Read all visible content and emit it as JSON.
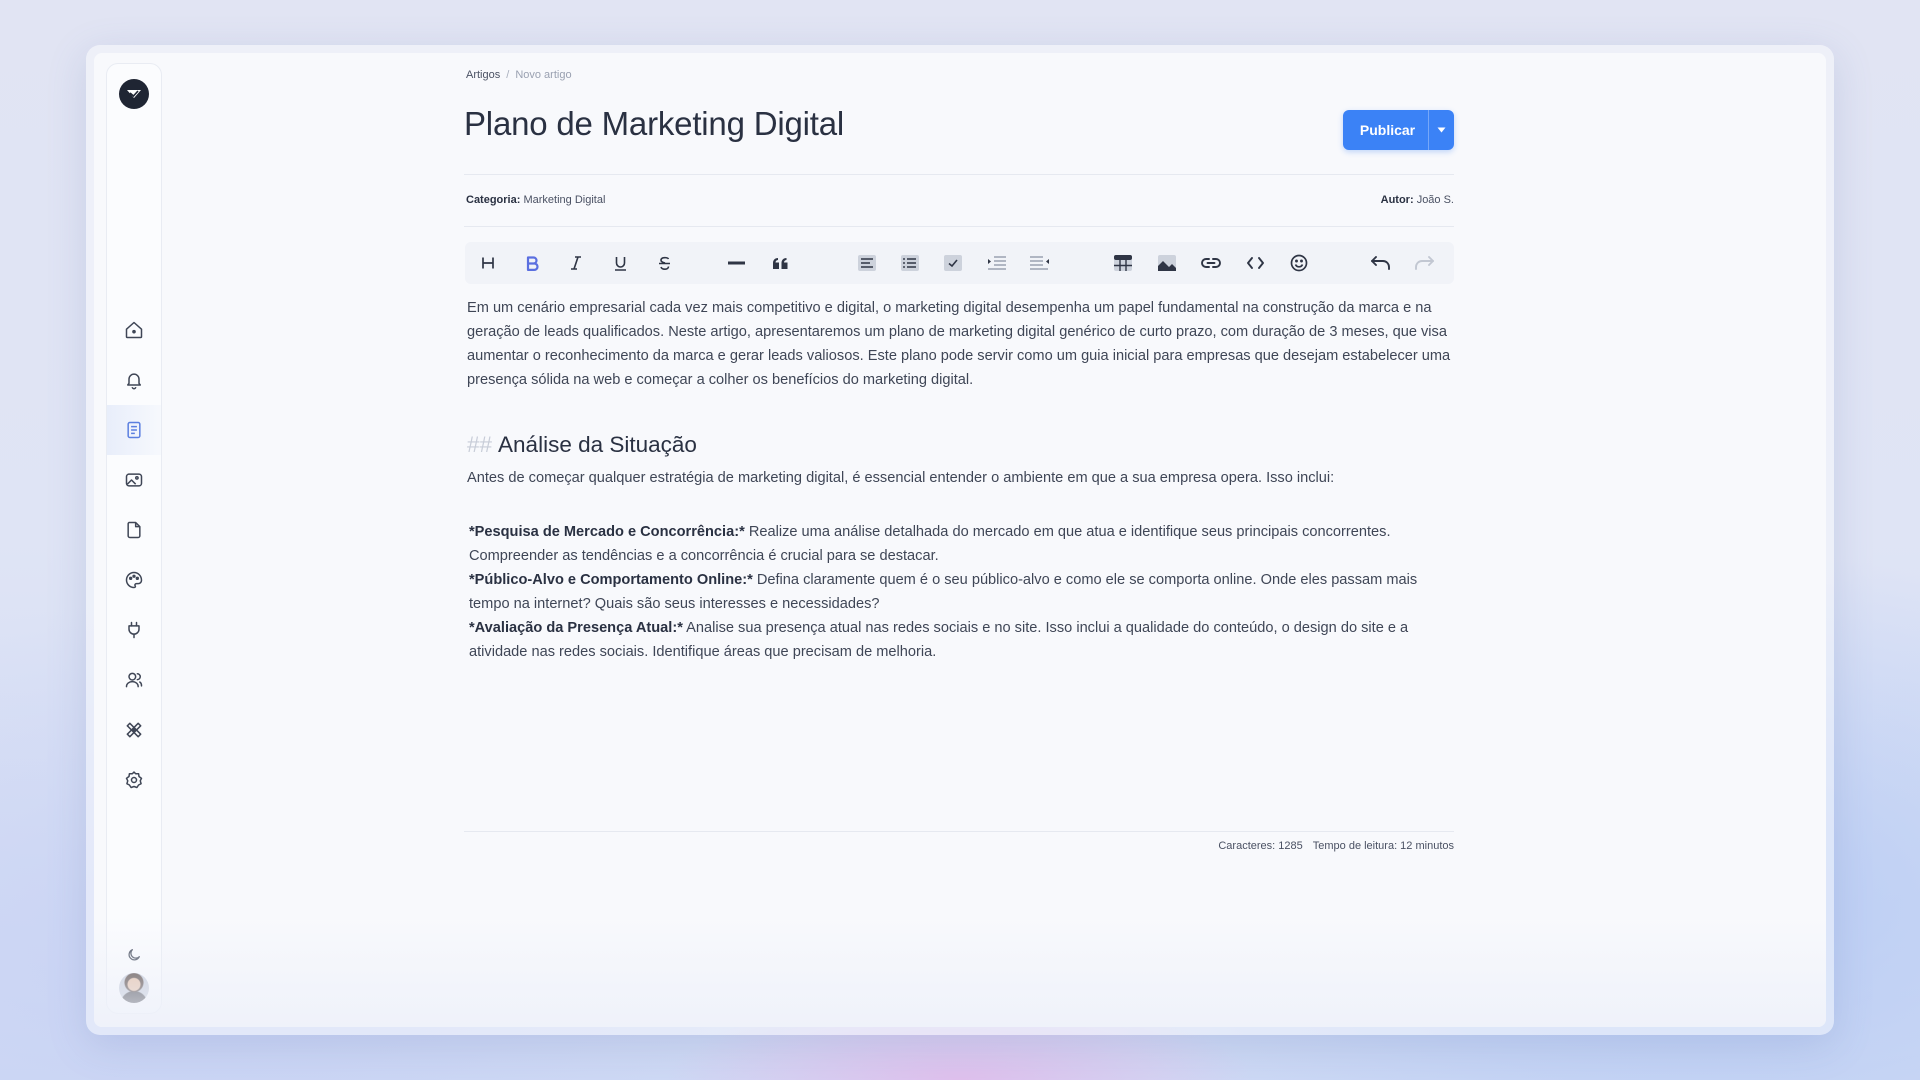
{
  "breadcrumb": {
    "parent": "Artigos",
    "separator": "/",
    "current": "Novo artigo"
  },
  "title": "Plano de Marketing Digital",
  "publish": {
    "label": "Publicar"
  },
  "meta": {
    "category_label": "Categoria:",
    "category_value": "Marketing Digital",
    "author_label": "Autor:",
    "author_value": "João S."
  },
  "sidebar": {
    "items": [
      {
        "name": "home-icon"
      },
      {
        "name": "bell-icon"
      },
      {
        "name": "document-icon",
        "active": true
      },
      {
        "name": "image-icon"
      },
      {
        "name": "file-icon"
      },
      {
        "name": "palette-icon"
      },
      {
        "name": "plug-icon"
      },
      {
        "name": "users-icon"
      },
      {
        "name": "tools-icon"
      },
      {
        "name": "settings-icon"
      }
    ],
    "bottom": [
      "moon-icon",
      "avatar"
    ]
  },
  "toolbar": [
    "heading-icon",
    "bold-icon",
    "italic-icon",
    "underline-icon",
    "strikethrough-icon",
    "horizontal-rule-icon",
    "quote-icon",
    "bullet-list-icon",
    "ordered-list-icon",
    "checklist-icon",
    "indent-icon",
    "outdent-icon",
    "table-icon",
    "image-icon",
    "link-icon",
    "code-icon",
    "emoji-icon",
    "undo-icon",
    "redo-icon"
  ],
  "content": {
    "intro": "Em um cenário empresarial cada vez mais competitivo e digital, o marketing digital desempenha um papel fundamental na construção da marca e na geração de leads qualificados. Neste artigo, apresentaremos um plano de marketing digital genérico de curto prazo, com duração de 3 meses, que visa aumentar o reconhecimento da marca e gerar leads valiosos. Este plano pode servir como um guia inicial para empresas que desejam estabelecer uma presença sólida na web e começar a colher os benefícios do marketing digital.",
    "heading_marker": "##",
    "heading": "Análise da Situação",
    "lead": "Antes de começar qualquer estratégia de marketing digital, é essencial entender o ambiente em que a sua empresa opera. Isso inclui:",
    "items": [
      {
        "title": "*Pesquisa de Mercado e Concorrência:*",
        "text": " Realize uma análise detalhada do mercado em que atua e identifique seus principais concorrentes. Compreender as tendências e a concorrência é crucial para se destacar."
      },
      {
        "title": "*Público-Alvo e Comportamento Online:*",
        "text": " Defina claramente quem é o seu público-alvo e como ele se comporta online. Onde eles passam mais tempo na internet? Quais são seus interesses e necessidades?"
      },
      {
        "title": "*Avaliação da Presença Atual:*",
        "text": " Analise sua presença atual nas redes sociais e no site. Isso inclui a qualidade do conteúdo, o design do site e a atividade nas redes sociais. Identifique áreas que precisam de melhoria."
      }
    ]
  },
  "stats": {
    "characters": "Caracteres: 1285",
    "reading_time": "Tempo de leitura: 12 minutos"
  },
  "colors": {
    "accent": "#3b82f6",
    "active_icon": "#5b7fe0"
  }
}
